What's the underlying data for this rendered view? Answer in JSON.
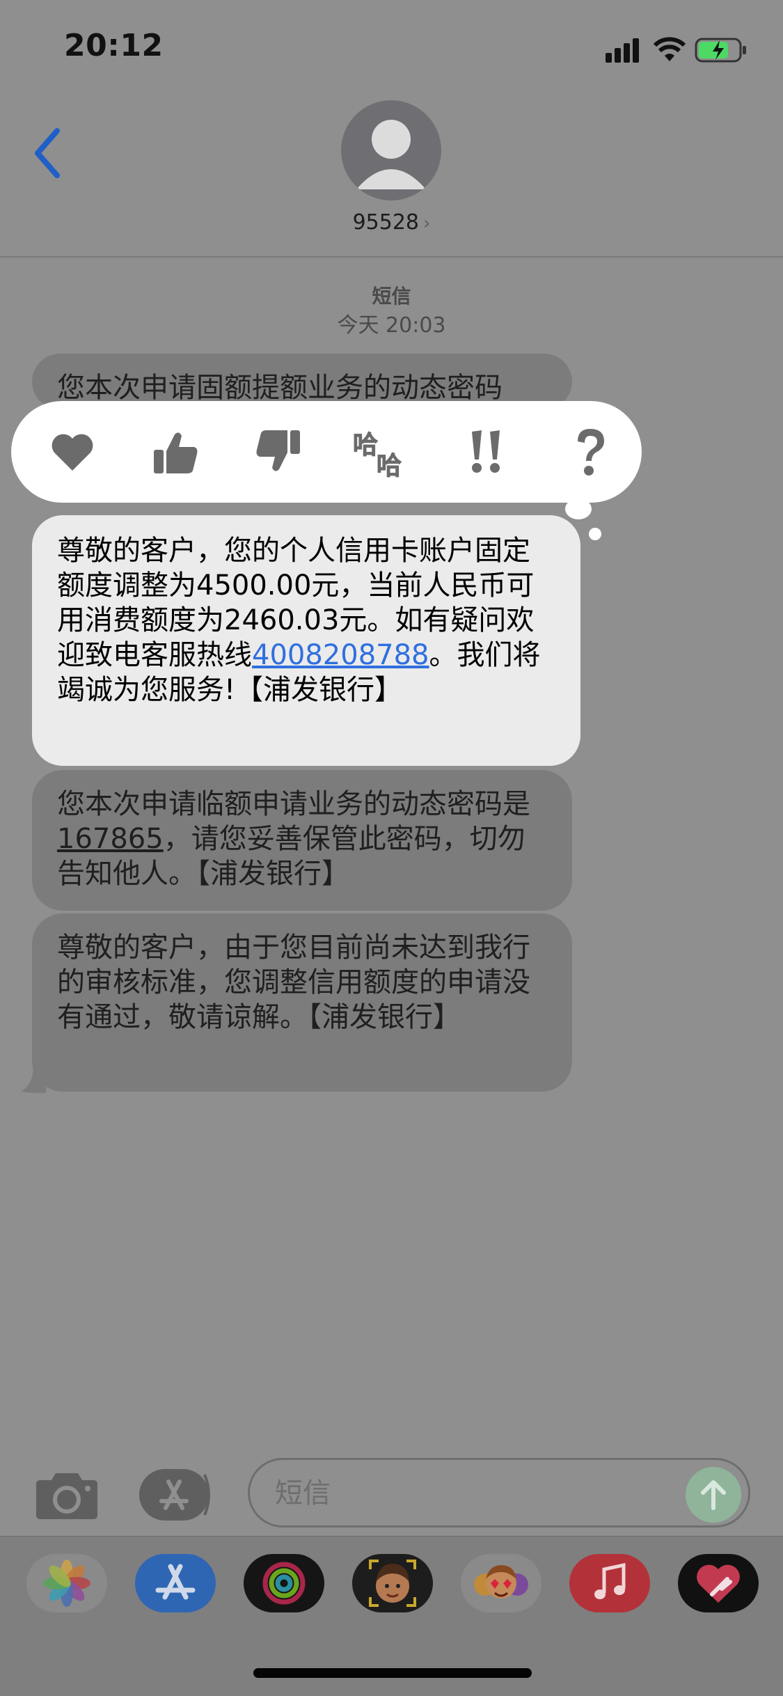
{
  "status_bar": {
    "time": "20:12"
  },
  "header": {
    "contact": "95528",
    "contact_chevron": "›"
  },
  "conversation": {
    "service": "短信",
    "timestamp": "今天 20:03"
  },
  "messages": {
    "m1_partial": "您本次申请固额提额业务的动态密码",
    "m2": {
      "part1": "尊敬的客户，您的个人信用卡账户固定额度调整为4500.00元，当前人民币可用消费额度为2460.03元。如有疑问欢迎致电客服热线",
      "link": "4008208788",
      "part2": "。我们将竭诚为您服务!【浦发银行】"
    },
    "m3": {
      "part1": "您本次申请临额申请业务的动态密码是",
      "code": "167865",
      "part2": "，请您妥善保管此密码，切勿告知他人。【浦发银行】"
    },
    "m4": "尊敬的客户，由于您目前尚未达到我行的审核标准，您调整信用额度的申请没有通过，敬请谅解。【浦发银行】"
  },
  "tapback": {
    "icons": [
      "heart-icon",
      "thumbs-up-icon",
      "thumbs-down-icon",
      "haha-icon",
      "exclamation-icon",
      "question-icon"
    ]
  },
  "compose": {
    "placeholder": "短信"
  },
  "app_tray": {
    "apps": [
      "photos-icon",
      "app-store-icon",
      "activity-icon",
      "memoji-icon",
      "animoji-icon",
      "music-icon",
      "digital-touch-icon"
    ]
  },
  "colors": {
    "background_dim": "#8f8f8f",
    "bubble_highlight": "#ebebeb",
    "link": "#2f6fe0",
    "back_arrow": "#1f5fc7"
  }
}
